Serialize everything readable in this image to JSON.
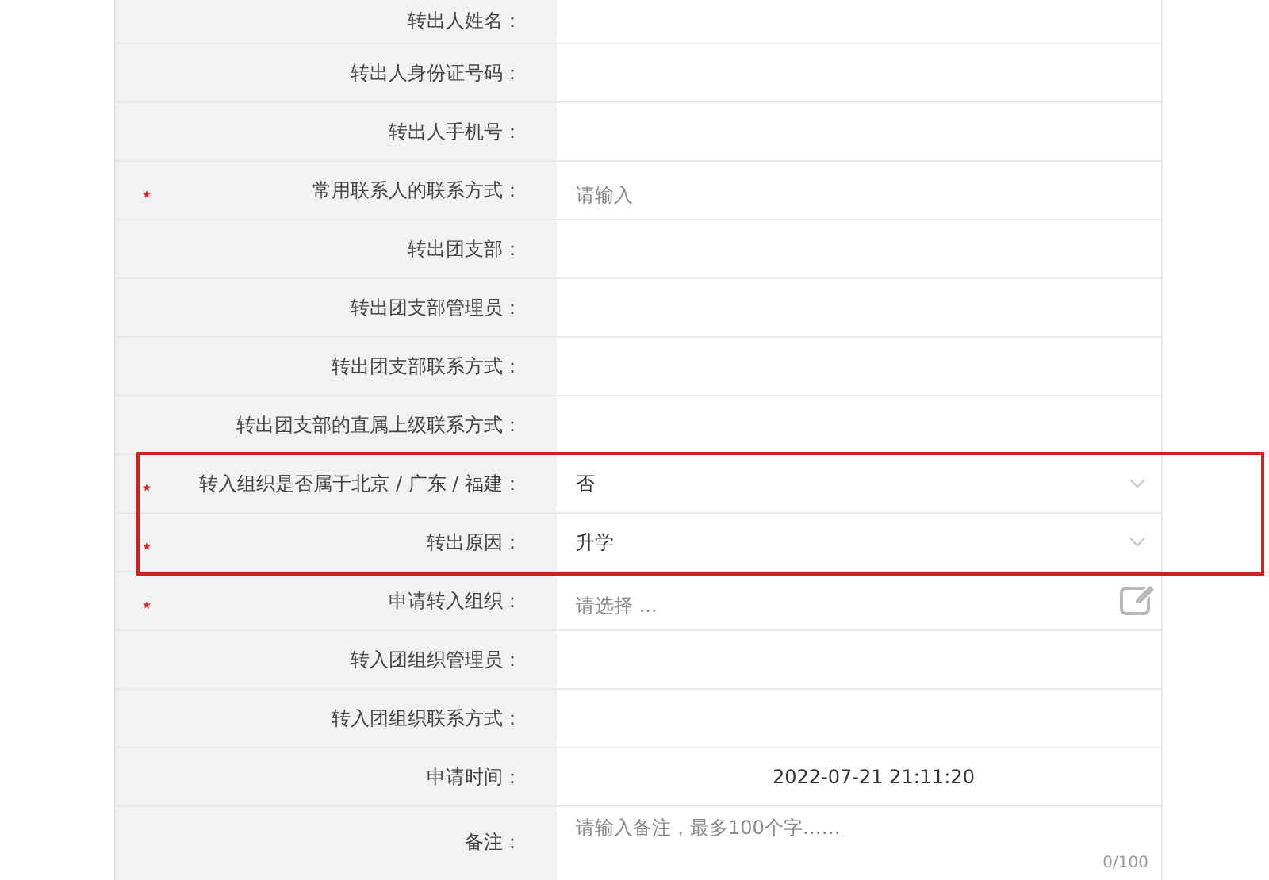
{
  "form": {
    "rows": [
      {
        "label": "转出人姓名：",
        "required": false,
        "highlighted": false,
        "kind": "empty"
      },
      {
        "label": "转出人身份证号码：",
        "required": false,
        "highlighted": false,
        "kind": "empty"
      },
      {
        "label": "转出人手机号：",
        "required": false,
        "highlighted": false,
        "kind": "empty"
      },
      {
        "label": "常用联系人的联系方式：",
        "required": true,
        "highlighted": false,
        "kind": "input",
        "placeholder": "请输入"
      },
      {
        "label": "转出团支部：",
        "required": false,
        "highlighted": false,
        "kind": "empty"
      },
      {
        "label": "转出团支部管理员：",
        "required": false,
        "highlighted": false,
        "kind": "empty"
      },
      {
        "label": "转出团支部联系方式：",
        "required": false,
        "highlighted": false,
        "kind": "empty"
      },
      {
        "label": "转出团支部的直属上级联系方式：",
        "required": false,
        "highlighted": false,
        "kind": "empty"
      },
      {
        "label": "转入组织是否属于北京 / 广东 / 福建：",
        "required": true,
        "highlighted": true,
        "kind": "select",
        "value": "否"
      },
      {
        "label": "转出原因：",
        "required": true,
        "highlighted": true,
        "kind": "select",
        "value": "升学"
      },
      {
        "label": "申请转入组织：",
        "required": true,
        "highlighted": false,
        "kind": "picker",
        "placeholder": "请选择 ..."
      },
      {
        "label": "转入团组织管理员：",
        "required": false,
        "highlighted": false,
        "kind": "empty"
      },
      {
        "label": "转入团组织联系方式：",
        "required": false,
        "highlighted": false,
        "kind": "empty"
      },
      {
        "label": "申请时间：",
        "required": false,
        "highlighted": false,
        "kind": "text",
        "value": "2022-07-21 21:11:20"
      },
      {
        "label": "备注：",
        "required": false,
        "highlighted": false,
        "kind": "textarea",
        "placeholder": "请输入备注，最多100个字……",
        "counter": "0/100"
      }
    ]
  }
}
